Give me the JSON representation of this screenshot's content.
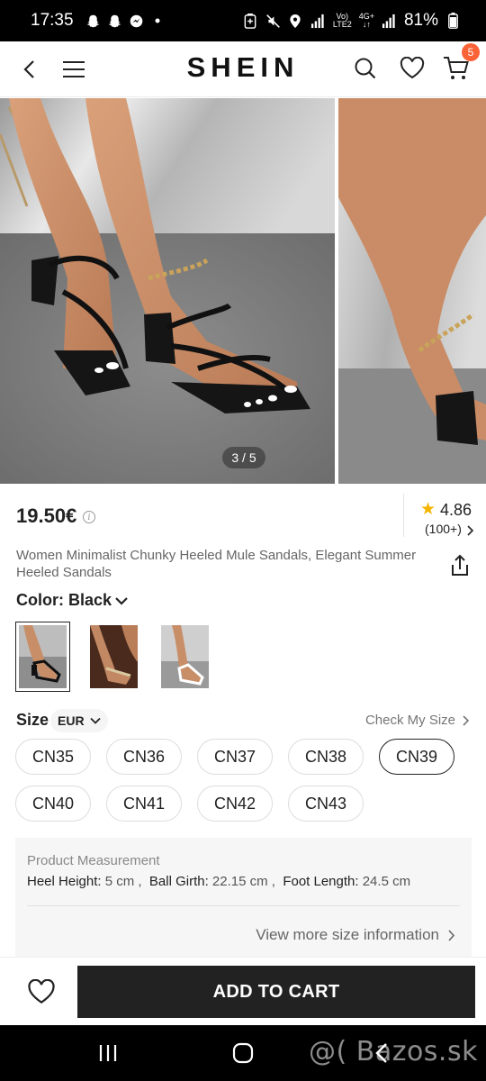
{
  "status_bar": {
    "time": "17:35",
    "network_top": "Vo)",
    "network_bottom": "LTE2",
    "data_top": "4G+",
    "battery": "81%"
  },
  "header": {
    "logo": "SHEIN",
    "cart_count": "5"
  },
  "gallery": {
    "counter": "3 / 5"
  },
  "product": {
    "price": "19.50€",
    "rating": "4.86",
    "review_count": "(100+)",
    "title": "Women Minimalist Chunky Heeled Mule Sandals, Elegant Summer Heeled Sandals"
  },
  "color": {
    "label": "Color: Black",
    "swatches_selected_index": 0
  },
  "size": {
    "label": "Size",
    "unit": "EUR",
    "check_label": "Check My Size",
    "options": [
      "CN35",
      "CN36",
      "CN37",
      "CN38",
      "CN39",
      "CN40",
      "CN41",
      "CN42",
      "CN43"
    ],
    "selected": "CN39"
  },
  "measurement": {
    "title": "Product Measurement",
    "heel_key": "Heel Height:",
    "heel_val": " 5 cm ,",
    "ball_key": "Ball Girth:",
    "ball_val": " 22.15 cm ,",
    "foot_key": "Foot Length:",
    "foot_val": " 24.5 cm",
    "more_link": "View more size information"
  },
  "actions": {
    "add_to_cart": "ADD TO CART"
  },
  "watermark": "@( Bazos.sk",
  "colors": {
    "accent": "#fa6338",
    "dark_button": "#222222",
    "star": "#f5b400"
  },
  "icons": [
    "back-arrow-icon",
    "menu-icon",
    "search-icon",
    "heart-icon",
    "cart-icon",
    "share-icon",
    "chevron-down-icon",
    "chevron-right-icon",
    "star-icon",
    "info-icon"
  ]
}
